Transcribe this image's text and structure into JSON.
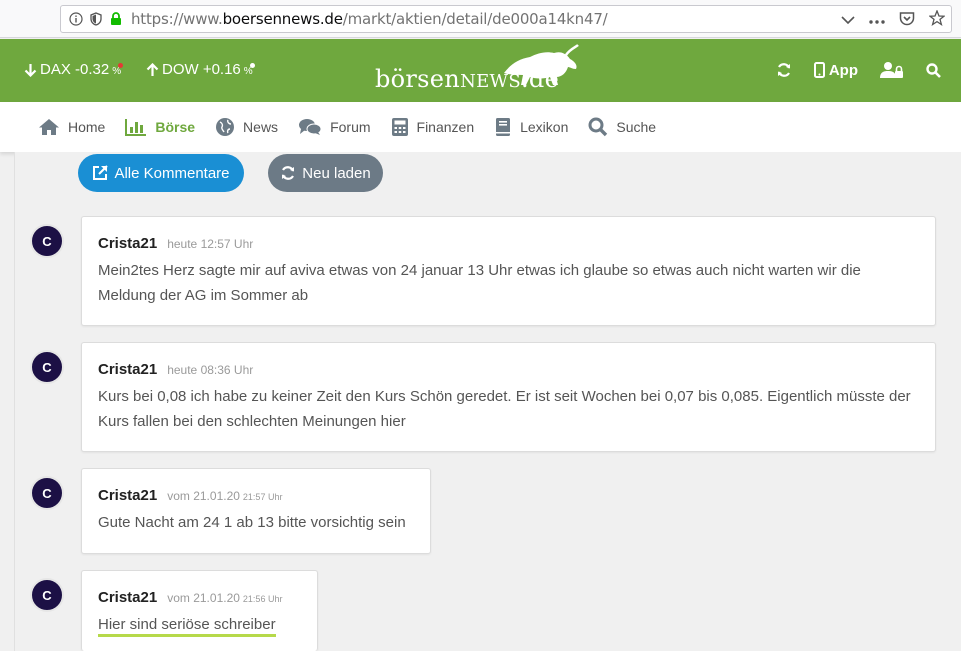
{
  "browser": {
    "url_prefix": "https://www.",
    "url_host": "boersennews.de",
    "url_path": "/markt/aktien/detail/de000a14kn47/"
  },
  "header": {
    "dax": {
      "label": "DAX -0.32",
      "pct": "%",
      "dot_color": "#e53935"
    },
    "dow": {
      "label": "DOW +0.16",
      "pct": "%",
      "dot_color": "#ffffff"
    },
    "logo_text_a": "börsen",
    "logo_text_b": "NEWS",
    "logo_text_c": ".de",
    "app_label": "App",
    "brand_color": "#6fa83e"
  },
  "nav": {
    "items": [
      {
        "label": "Home",
        "icon": "home-icon"
      },
      {
        "label": "Börse",
        "icon": "chart-icon",
        "active": true
      },
      {
        "label": "News",
        "icon": "globe-icon"
      },
      {
        "label": "Forum",
        "icon": "comments-icon"
      },
      {
        "label": "Finanzen",
        "icon": "calculator-icon"
      },
      {
        "label": "Lexikon",
        "icon": "book-icon"
      },
      {
        "label": "Suche",
        "icon": "search-icon"
      }
    ]
  },
  "buttons": {
    "all_comments": "Alle Kommentare",
    "reload": "Neu laden"
  },
  "comments": [
    {
      "avatar": "C",
      "author": "Crista21",
      "time": "heute 12:57 Uhr",
      "time_small": "",
      "text": "Mein2tes Herz sagte mir auf aviva etwas von 24 januar 13 Uhr etwas ich glaube so etwas auch nicht warten wir die Meldung der AG im Sommer ab"
    },
    {
      "avatar": "C",
      "author": "Crista21",
      "time": "heute 08:36 Uhr",
      "time_small": "",
      "text": "Kurs bei 0,08 ich habe zu keiner Zeit den Kurs Schön geredet. Er ist seit Wochen bei 0,07 bis 0,085. Eigentlich müsste der Kurs fallen bei den schlechten Meinungen hier"
    },
    {
      "avatar": "C",
      "author": "Crista21",
      "time": "vom 21.01.20",
      "time_small": "21:57 Uhr",
      "text": "Gute Nacht am 24 1 ab 13 bitte vorsichtig sein"
    },
    {
      "avatar": "C",
      "author": "Crista21",
      "time": "vom 21.01.20",
      "time_small": "21:56 Uhr",
      "text": "Hier sind seriöse schreiber"
    }
  ]
}
